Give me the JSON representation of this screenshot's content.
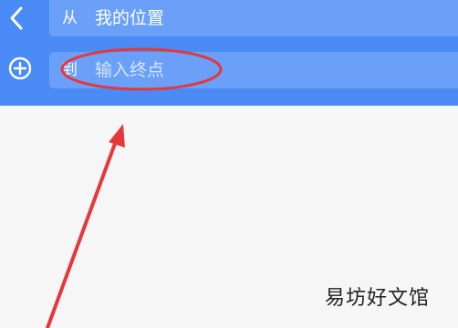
{
  "route": {
    "from_prefix": "从",
    "from_value": "我的位置",
    "to_prefix": "到",
    "to_placeholder": "输入终点"
  },
  "watermark": "易坊好文馆",
  "colors": {
    "header": "#4a8bf6",
    "field": "#6aa0f8",
    "annotation": "#e5383b"
  },
  "icons": {
    "back": "chevron-left",
    "add_stop": "plus-circle"
  }
}
